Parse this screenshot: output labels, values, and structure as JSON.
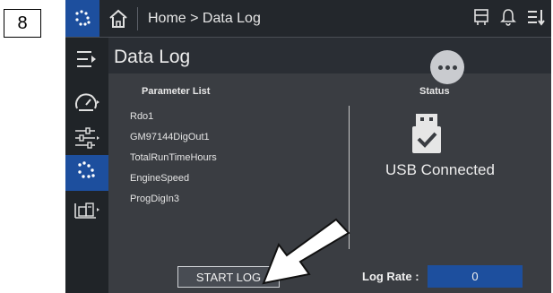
{
  "step_number": "8",
  "breadcrumb": "Home > Data Log",
  "page_title": "Data Log",
  "parameter_list": {
    "heading": "Parameter List",
    "items": [
      "Rdo1",
      "GM97144DigOut1",
      "TotalRunTimeHours",
      "EngineSpeed",
      "ProgDigIn3"
    ]
  },
  "status": {
    "heading": "Status",
    "text": "USB Connected"
  },
  "start_log_label": "START LOG",
  "log_rate": {
    "label": "Log Rate :",
    "value": "0"
  },
  "colors": {
    "accent": "#1d4f9e",
    "background": "#3a3d42",
    "topbar": "#23272c"
  }
}
